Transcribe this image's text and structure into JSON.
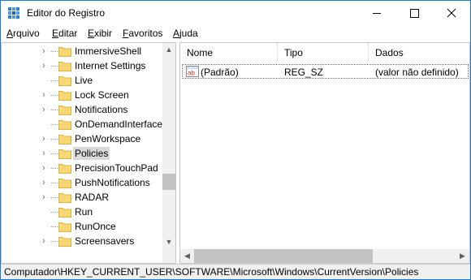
{
  "window": {
    "title": "Editor do Registro"
  },
  "menu": [
    "Arquivo",
    "Editar",
    "Exibir",
    "Favoritos",
    "Ajuda"
  ],
  "tree": {
    "items": [
      {
        "label": "ImmersiveShell",
        "expandable": true,
        "selected": false
      },
      {
        "label": "Internet Settings",
        "expandable": true,
        "selected": false
      },
      {
        "label": "Live",
        "expandable": false,
        "selected": false
      },
      {
        "label": "Lock Screen",
        "expandable": true,
        "selected": false
      },
      {
        "label": "Notifications",
        "expandable": true,
        "selected": false
      },
      {
        "label": "OnDemandInterface",
        "expandable": false,
        "selected": false
      },
      {
        "label": "PenWorkspace",
        "expandable": true,
        "selected": false
      },
      {
        "label": "Policies",
        "expandable": true,
        "selected": true
      },
      {
        "label": "PrecisionTouchPad",
        "expandable": true,
        "selected": false
      },
      {
        "label": "PushNotifications",
        "expandable": true,
        "selected": false
      },
      {
        "label": "RADAR",
        "expandable": true,
        "selected": false
      },
      {
        "label": "Run",
        "expandable": false,
        "selected": false
      },
      {
        "label": "RunOnce",
        "expandable": false,
        "selected": false
      },
      {
        "label": "Screensavers",
        "expandable": true,
        "selected": false
      }
    ]
  },
  "list": {
    "columns": [
      "Nome",
      "Tipo",
      "Dados"
    ],
    "rows": [
      {
        "name": "(Padrão)",
        "type": "REG_SZ",
        "data": "(valor não definido)",
        "icon": "string-value-icon"
      }
    ]
  },
  "status": {
    "path": "Computador\\HKEY_CURRENT_USER\\SOFTWARE\\Microsoft\\Windows\\CurrentVersion\\Policies"
  },
  "colors": {
    "accent": "#1a7bd4",
    "folder": "#f8d775",
    "selection": "#d9d9d9"
  }
}
